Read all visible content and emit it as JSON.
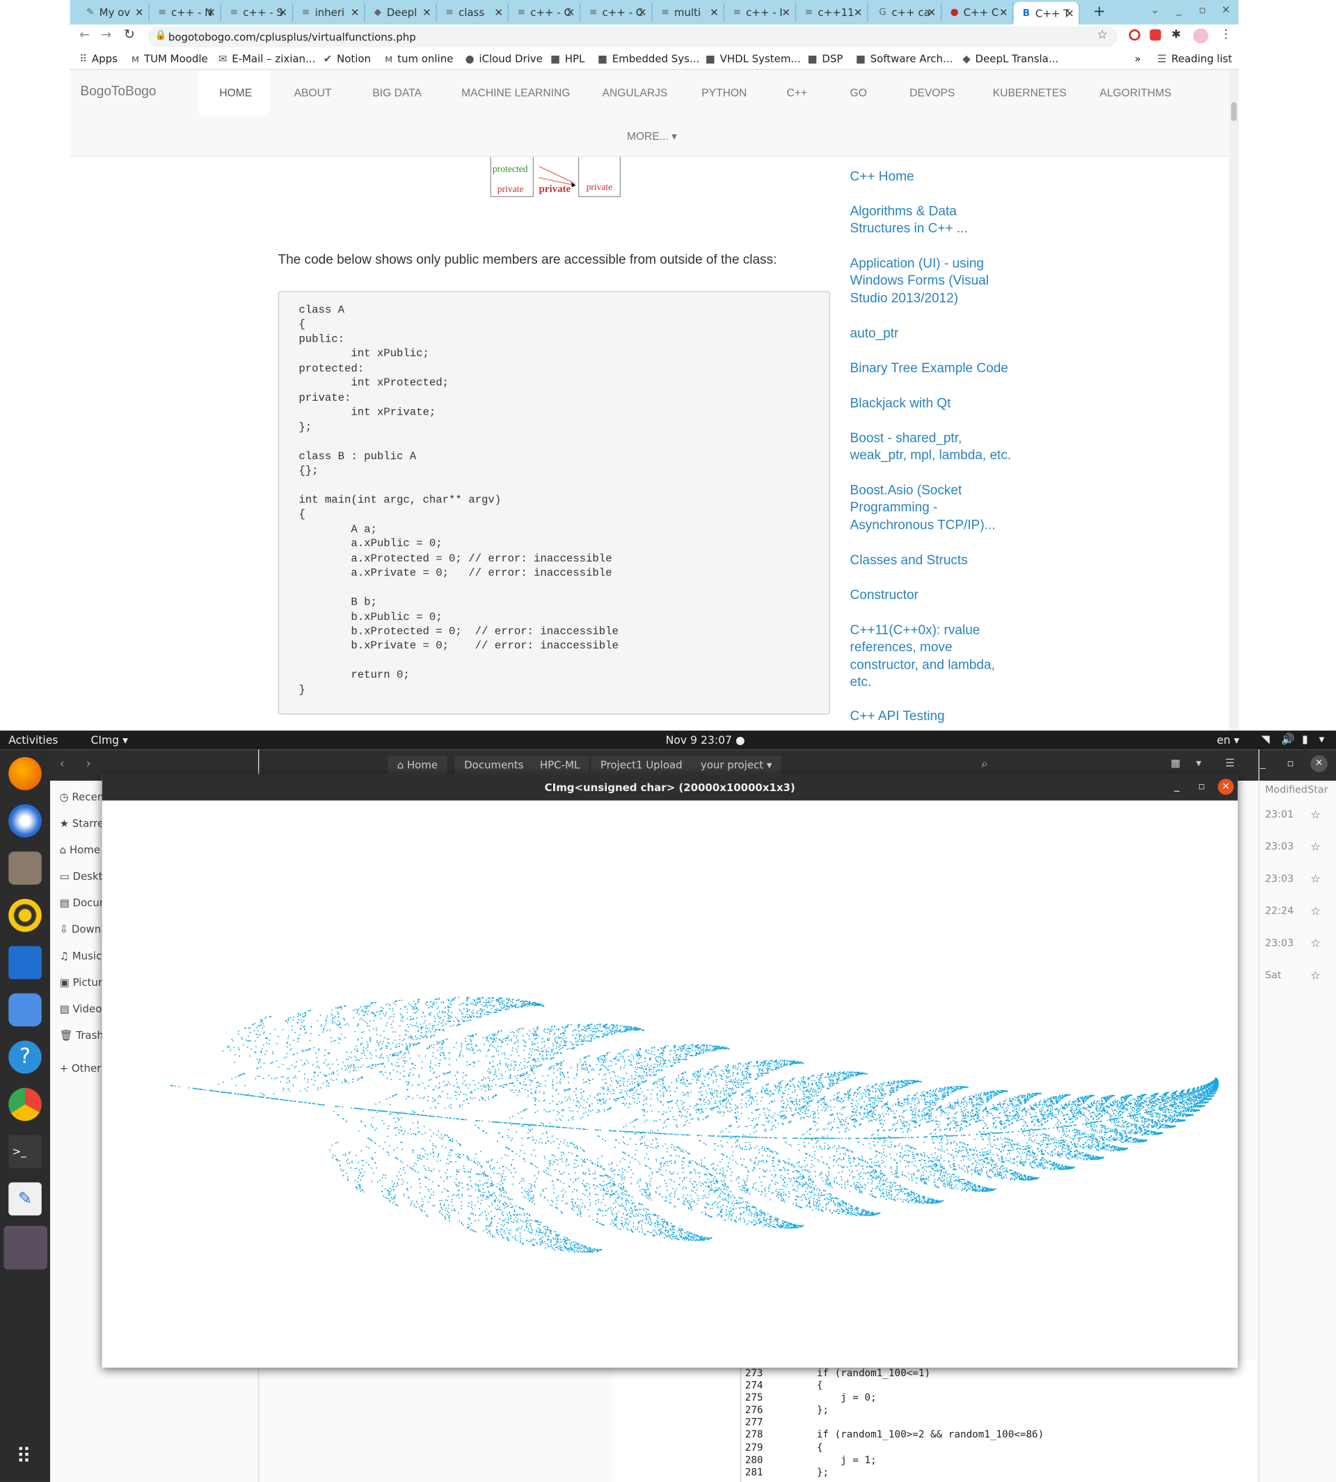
{
  "browser": {
    "tabs": [
      {
        "label": "My ov",
        "icon": "pen-icon"
      },
      {
        "label": "c++ - N",
        "icon": "stack-icon"
      },
      {
        "label": "c++ - S",
        "icon": "stack-icon"
      },
      {
        "label": "inheri",
        "icon": "stack-icon"
      },
      {
        "label": "Deepl",
        "icon": "deepl-icon"
      },
      {
        "label": "class",
        "icon": "stack-icon"
      },
      {
        "label": "c++ - C",
        "icon": "stack-icon"
      },
      {
        "label": "c++ - C",
        "icon": "stack-icon"
      },
      {
        "label": "multi",
        "icon": "stack-icon"
      },
      {
        "label": "c++ - I",
        "icon": "stack-icon"
      },
      {
        "label": "c++11",
        "icon": "stack-icon"
      },
      {
        "label": "c++ ca",
        "icon": "google-icon"
      },
      {
        "label": "C++ C",
        "icon": "red-icon"
      },
      {
        "label": "C++ T",
        "icon": "b-icon"
      }
    ],
    "url": "bogotobogo.com/cplusplus/virtualfunctions.php",
    "bookmarks": [
      "Apps",
      "TUM Moodle",
      "E-Mail – zixian...",
      "Notion",
      "tum online",
      "iCloud Drive",
      "HPL",
      "Embedded Sys...",
      "VHDL System...",
      "DSP",
      "Software Arch...",
      "DeepL Transla..."
    ],
    "reading_list": "Reading list"
  },
  "site": {
    "brand": "BogoToBogo",
    "nav": [
      "HOME",
      "ABOUT",
      "BIG DATA",
      "MACHINE LEARNING",
      "ANGULARJS",
      "PYTHON",
      "C++",
      "GO",
      "DEVOPS",
      "KUBERNETES",
      "ALGORITHMS"
    ],
    "more": "MORE...",
    "diagram": {
      "protected": "protected",
      "private1": "private",
      "private2": "private",
      "private3": "private"
    },
    "intro": "The code below shows only public members are accessible from outside of the class:",
    "code": "class A\n{\npublic:\n        int xPublic;\nprotected:\n        int xProtected;\nprivate:\n        int xPrivate;\n};\n\nclass B : public A\n{};\n\nint main(int argc, char** argv)\n{\n        A a;\n        a.xPublic = 0;\n        a.xProtected = 0; // error: inaccessible\n        a.xPrivate = 0;   // error: inaccessible\n\n        B b;\n        b.xPublic = 0;\n        b.xProtected = 0;  // error: inaccessible\n        b.xPrivate = 0;    // error: inaccessible\n\n        return 0;\n}",
    "sidebar": [
      "C++ Home",
      "Algorithms & Data Structures in C++ ...",
      "Application (UI) - using Windows Forms (Visual Studio 2013/2012)",
      "auto_ptr",
      "Binary Tree Example Code",
      "Blackjack with Qt",
      "Boost - shared_ptr, weak_ptr, mpl, lambda, etc.",
      "Boost.Asio (Socket Programming - Asynchronous TCP/IP)...",
      "Classes and Structs",
      "Constructor",
      "C++11(C++0x): rvalue references, move constructor, and lambda, etc.",
      "C++ API Testing"
    ]
  },
  "desktop": {
    "activities": "Activities",
    "app_menu": "CImg",
    "clock": "Nov 9  23:07",
    "lang": "en",
    "files": {
      "breadcrumbs": [
        "Home",
        "Documents",
        "HPC-ML",
        "Project1 Upload",
        "your project"
      ],
      "sidebar": [
        "Recent",
        "Starred",
        "Home",
        "Desktop",
        "Documents",
        "Downloads",
        "Music",
        "Pictures",
        "Videos",
        "Trash",
        "Other Locations"
      ],
      "columns": {
        "modified": "Modified",
        "star": "Star"
      },
      "times": [
        "23:01",
        "23:03",
        "23:03",
        "22:24",
        "23:03",
        "Sat"
      ]
    },
    "editor_lines": [
      {
        "n": "273",
        "text": "        if (random1_100<=1)"
      },
      {
        "n": "274",
        "text": "        {"
      },
      {
        "n": "275",
        "text": "            j = 0;"
      },
      {
        "n": "276",
        "text": "        };"
      },
      {
        "n": "277",
        "text": ""
      },
      {
        "n": "278",
        "text": "        if (random1_100>=2 && random1_100<=86)"
      },
      {
        "n": "279",
        "text": "        {"
      },
      {
        "n": "280",
        "text": "            j = 1;"
      },
      {
        "n": "281",
        "text": "        };"
      }
    ],
    "cimg_title": "CImg<unsigned char> (20000x10000x1x3)",
    "fern_color": "#1aa6dd"
  }
}
